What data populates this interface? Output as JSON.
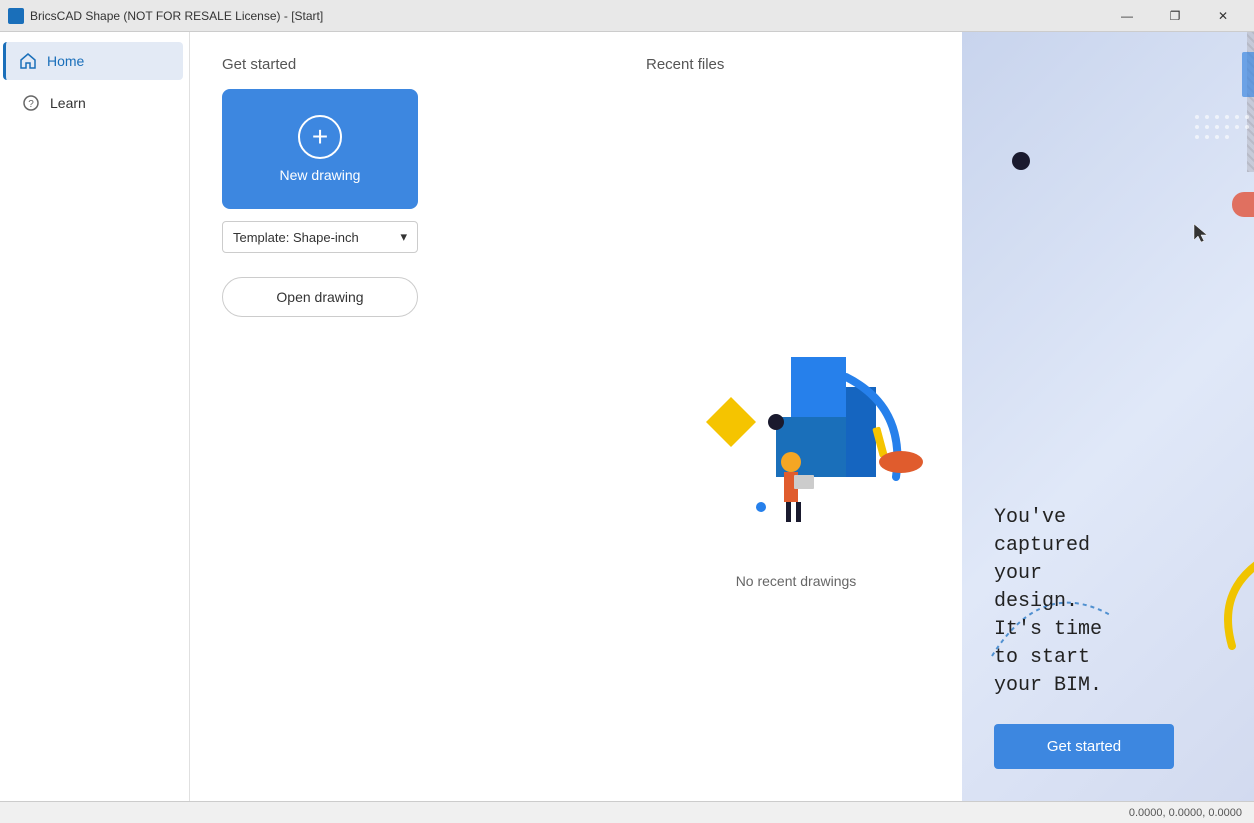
{
  "titleBar": {
    "title": "BricsCAD Shape (NOT FOR RESALE License) - [Start]",
    "minimizeLabel": "—",
    "maximizeLabel": "❐",
    "closeLabel": "✕"
  },
  "sidebar": {
    "items": [
      {
        "id": "home",
        "label": "Home",
        "icon": "home-icon",
        "active": true
      },
      {
        "id": "learn",
        "label": "Learn",
        "icon": "help-icon",
        "active": false
      }
    ]
  },
  "getStarted": {
    "sectionTitle": "Get started",
    "newDrawingLabel": "New drawing",
    "templateLabel": "Template:  Shape-inch",
    "openDrawingLabel": "Open drawing"
  },
  "recentFiles": {
    "sectionTitle": "Recent files",
    "noRecentText": "No recent drawings"
  },
  "promo": {
    "text": "You've\ncaptured\nyour\ndesign.\nIt's time\nto start\nyour BIM.",
    "buttonLabel": "Get started"
  },
  "statusBar": {
    "coordinates": "0.0000, 0.0000, 0.0000"
  },
  "colors": {
    "accent": "#3d87e0",
    "sidebar_active_bg": "#e3eaf5",
    "promo_bg": "#d4dcf0"
  }
}
